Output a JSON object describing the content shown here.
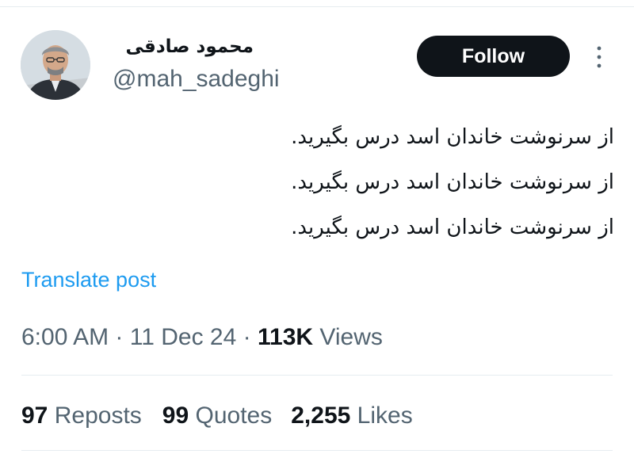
{
  "user": {
    "display_name": "محمود صادقی",
    "handle": "@mah_sadeghi"
  },
  "actions": {
    "follow_label": "Follow"
  },
  "post": {
    "lines": [
      "از سرنوشت خاندان اسد درس بگیرید.",
      "از سرنوشت خاندان اسد درس بگیرید.",
      "از سرنوشت خاندان اسد درس بگیرید."
    ],
    "translate_label": "Translate post",
    "time": "6:00 AM",
    "date": "11 Dec 24",
    "separator": "·",
    "views_count": "113K",
    "views_label": "Views"
  },
  "stats": {
    "reposts_count": "97",
    "reposts_label": "Reposts",
    "quotes_count": "99",
    "quotes_label": "Quotes",
    "likes_count": "2,255",
    "likes_label": "Likes"
  },
  "icons": {
    "more": "more-vertical-icon",
    "avatar": "user-avatar"
  },
  "colors": {
    "follow_bg": "#0f1419",
    "link": "#1d9bf0",
    "secondary_text": "#536471"
  }
}
